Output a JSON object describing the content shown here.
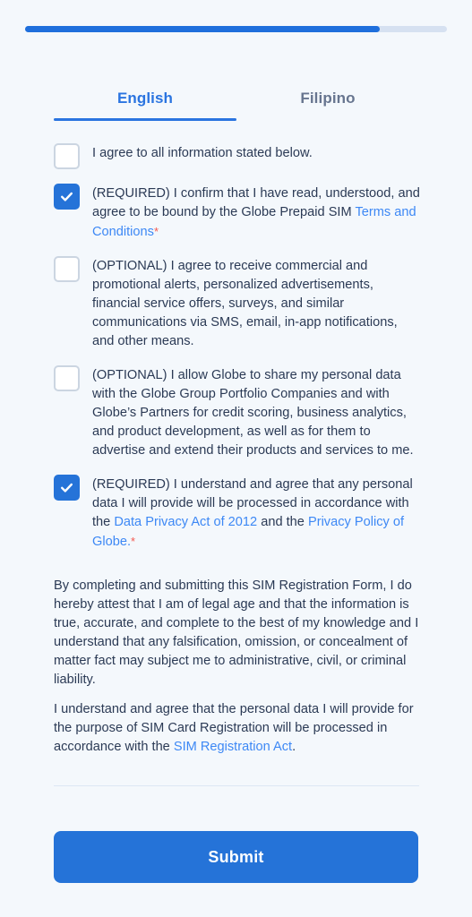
{
  "colors": {
    "background": "#f4f8fc",
    "accent": "#2573d8",
    "progress_fill": "#1f6fdc",
    "progress_track": "#d6e1f1",
    "link": "#3d88f5",
    "text": "#2b3a55",
    "tab_inactive": "#67758f",
    "required_star": "#f4584f",
    "divider": "#dde7f3"
  },
  "progress": {
    "percent": 84,
    "label": "84%"
  },
  "tabs": [
    {
      "label": "English",
      "active": true
    },
    {
      "label": "Filipino",
      "active": false
    }
  ],
  "consents": [
    {
      "checked": false,
      "text_1": "I agree to all information stated below.",
      "link_1": "",
      "text_2": "",
      "link_2": "",
      "text_3": "",
      "star": false
    },
    {
      "checked": true,
      "text_1": "(REQUIRED) I confirm that I have read, understood, and agree to be bound by the Globe Prepaid SIM ",
      "link_1": "Terms and Conditions",
      "text_2": "",
      "link_2": "",
      "text_3": "",
      "star": true
    },
    {
      "checked": false,
      "text_1": "(OPTIONAL) I agree to receive commercial and promotional alerts, personalized advertisements, financial service offers, surveys, and similar communications via SMS, email, in-app notifications, and other means.",
      "link_1": "",
      "text_2": "",
      "link_2": "",
      "text_3": "",
      "star": false
    },
    {
      "checked": false,
      "text_1": "(OPTIONAL) I allow Globe to share my personal data with the Globe Group Portfolio Companies and with Globe’s Partners for credit scoring, business analytics, and product development, as well as for them to advertise and extend their products and services to me.",
      "link_1": "",
      "text_2": "",
      "link_2": "",
      "text_3": "",
      "star": false
    },
    {
      "checked": true,
      "text_1": "(REQUIRED) I understand and agree that any personal data I will provide will be processed in accordance with the ",
      "link_1": "Data Privacy Act of 2012",
      "text_2": " and the ",
      "link_2": "Privacy Policy of Globe.",
      "text_3": "",
      "star": true
    }
  ],
  "paragraphs": [
    {
      "text_1": "By completing and submitting this SIM Registration Form, I do hereby attest that I am of legal age and that the information is true, accurate, and complete to the best of my knowledge and I understand that any falsification, omission, or concealment of matter fact may subject me to administrative, civil, or criminal liability.",
      "link_1": "",
      "text_2": ""
    },
    {
      "text_1": "I understand and agree that the personal data I will provide for the purpose of SIM Card Registration will be processed in accordance with the ",
      "link_1": "SIM Registration Act",
      "text_2": "."
    }
  ],
  "submit": {
    "label": "Submit"
  }
}
